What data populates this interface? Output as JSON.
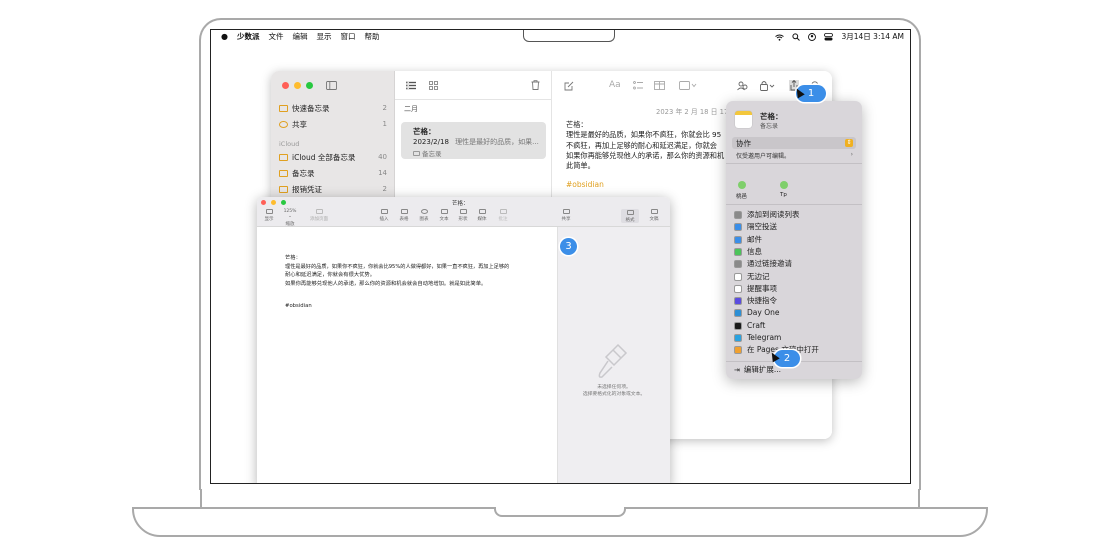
{
  "menubar": {
    "apple": "",
    "app": "少数派",
    "menus": [
      "文件",
      "编辑",
      "显示",
      "窗口",
      "帮助"
    ],
    "datetime": "3月14日 3:14 AM"
  },
  "notes": {
    "sidebar": [
      {
        "label": "快速备忘录",
        "count": "2"
      },
      {
        "label": "共享",
        "count": "1"
      }
    ],
    "icloud_header": "iCloud",
    "folders": [
      {
        "label": "iCloud 全部备忘录",
        "count": "40"
      },
      {
        "label": "备忘录",
        "count": "14"
      },
      {
        "label": "报销凭证",
        "count": "2"
      }
    ],
    "month": "二月",
    "note_card": {
      "title": "芒格：",
      "date": "2023/2/18",
      "preview": "理性是最好的品质，如果...",
      "folder": "备忘录"
    },
    "timestamp": "2023 年 2 月 18 日 17:02",
    "body": [
      "芒格：",
      "理性是最好的品质，如果你不疯狂，你就会比 95",
      "不疯狂，再加上足够的耐心和延迟满足，你就会",
      "如果你再能够兑现他人的承诺，那么你的资源和机",
      "此简单。"
    ],
    "tag": "#obsidian"
  },
  "pages": {
    "title": "芒格：",
    "zoom": "125% ⌄",
    "toolbar_left": [
      "显示",
      "缩放",
      "添加页面"
    ],
    "toolbar_mid": [
      "插入",
      "表格",
      "图表",
      "文本",
      "形状",
      "媒体",
      "批注"
    ],
    "toolbar_right": [
      "共享",
      "格式",
      "文稿"
    ],
    "doc_lines": [
      "芒格：",
      "理性是最好的品质，如果你不疯狂，你就会比95%的人做得都好，如果一直不疯狂，再加上足够的",
      "耐心和延迟满足，你就会有很大优势。",
      "如果你再能够兑现他人的承诺，那么你的资源和机会就会自动地增加。就是如此简单。"
    ],
    "tag": "#obsidian",
    "empty_line1": "未选择任何项。",
    "empty_line2": "选择要格式化的对象或文本。"
  },
  "share": {
    "title": "芒格：",
    "subtitle": "备忘录",
    "collab": "协作",
    "perm": "仅受邀用户可编辑。",
    "people": [
      {
        "name": "桃邑",
        "color": "#7fcf6b"
      },
      {
        "name": "Tp",
        "color": "#7fcf6b"
      }
    ],
    "items": [
      {
        "label": "添加到阅读列表",
        "color": "#8a8a8a"
      },
      {
        "label": "隔空投送",
        "color": "#3a8ee8"
      },
      {
        "label": "邮件",
        "color": "#3a8ee8"
      },
      {
        "label": "信息",
        "color": "#4cc35a"
      },
      {
        "label": "通过链接邀请",
        "color": "#8a8a8a"
      },
      {
        "label": "无边记",
        "color": "#ffffff"
      },
      {
        "label": "提醒事项",
        "color": "#ffffff"
      },
      {
        "label": "快捷指令",
        "color": "#5b4ce0"
      },
      {
        "label": "Day One",
        "color": "#2d8fd5"
      },
      {
        "label": "Craft",
        "color": "#1a1a1a"
      },
      {
        "label": "Telegram",
        "color": "#2aa2e0"
      },
      {
        "label": "在 Pages 文稿中打开",
        "color": "#f0a030"
      }
    ],
    "edit_ext": "编辑扩展..."
  },
  "badges": [
    "1",
    "2",
    "3"
  ],
  "colors": {
    "red": "#ff5f57",
    "yellow": "#febc2e",
    "green": "#28c840",
    "accent": "#3b8ee8",
    "folder": "#e0a020"
  }
}
